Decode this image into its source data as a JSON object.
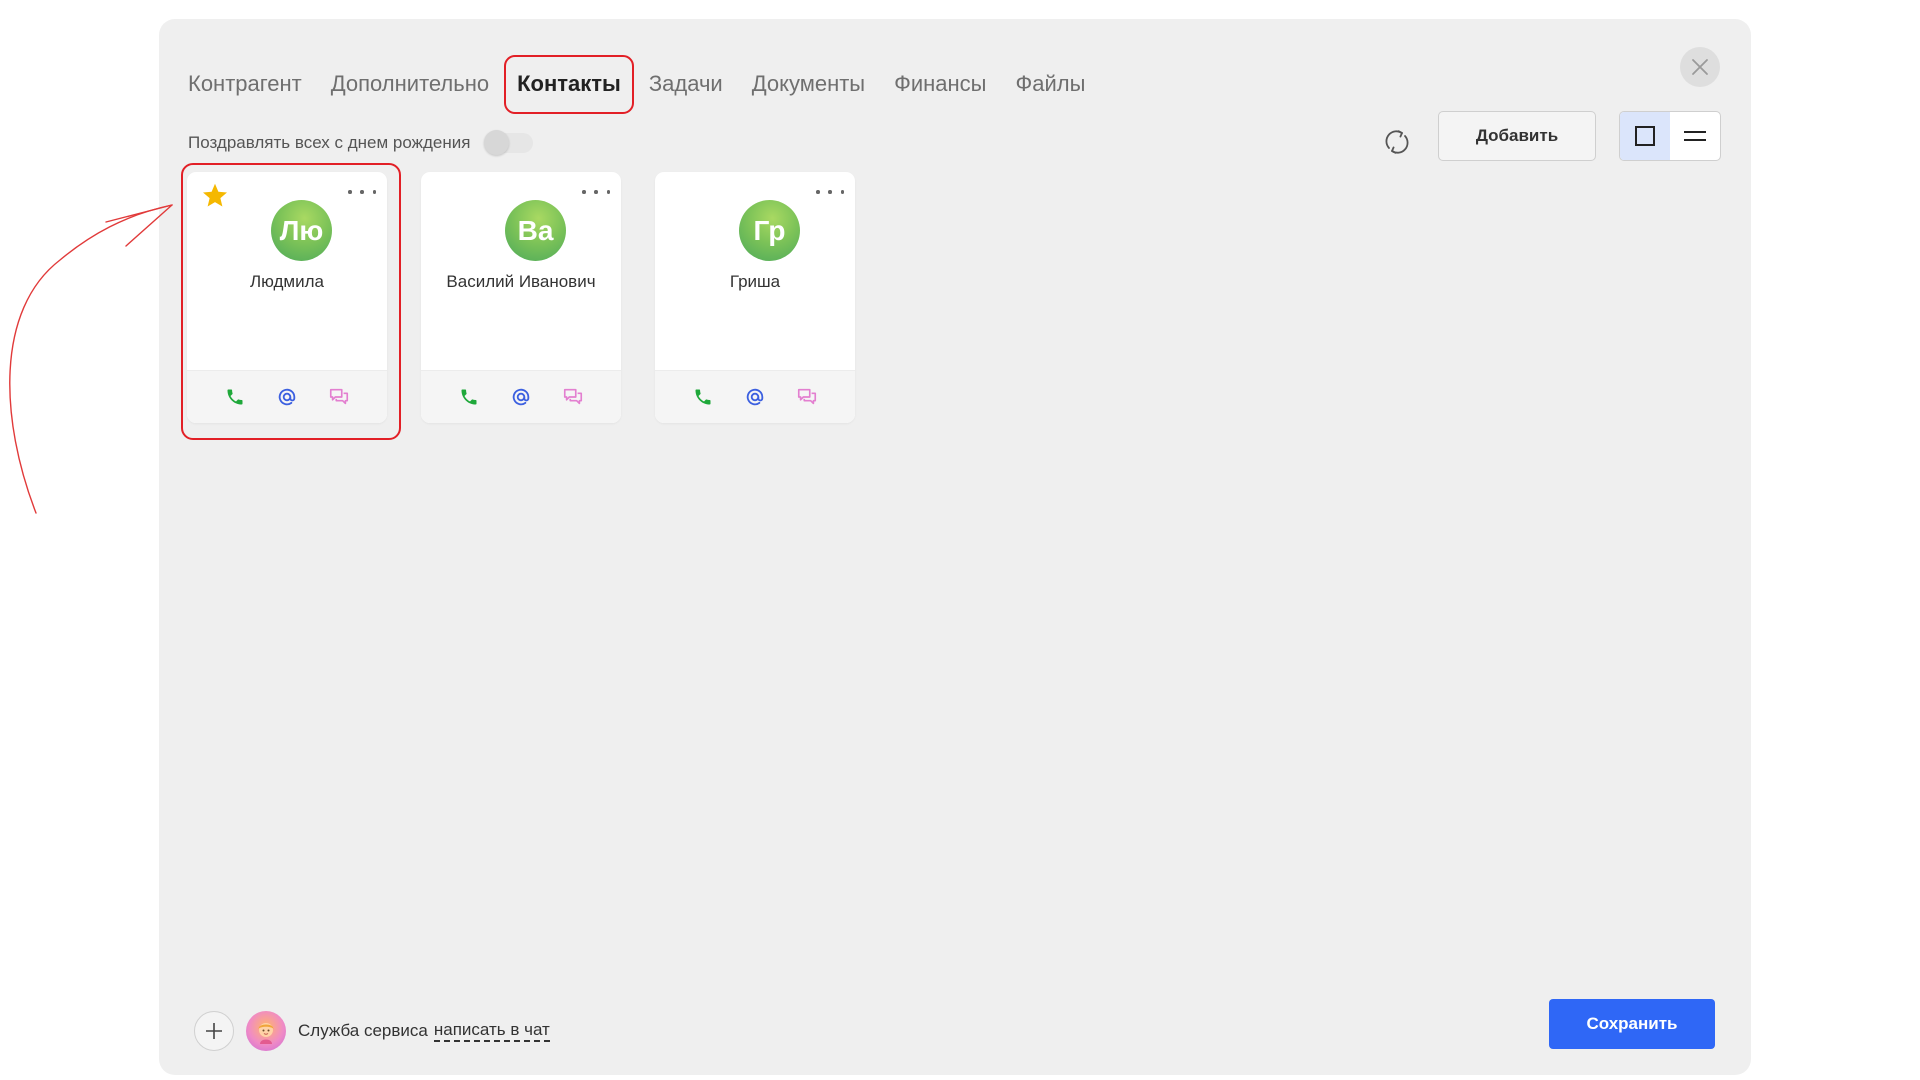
{
  "tabs": [
    {
      "label": "Контрагент"
    },
    {
      "label": "Дополнительно"
    },
    {
      "label": "Контакты",
      "active": true
    },
    {
      "label": "Задачи"
    },
    {
      "label": "Документы"
    },
    {
      "label": "Финансы"
    },
    {
      "label": "Файлы"
    }
  ],
  "toolbar": {
    "birthday_label": "Поздравлять всех с днем рождения",
    "birthday_enabled": false,
    "add_label": "Добавить",
    "view_mode": "cards",
    "icons": [
      "refresh-icon",
      "card-view-icon",
      "list-view-icon",
      "close-icon"
    ]
  },
  "contacts": [
    {
      "initials": "Лю",
      "name": "Людмила",
      "favorite": true
    },
    {
      "initials": "Ва",
      "name": "Василий Иванович",
      "favorite": false
    },
    {
      "initials": "Гр",
      "name": "Гриша",
      "favorite": false
    }
  ],
  "footer": {
    "support_label": "Служба сервиса",
    "chat_link": "написать в чат",
    "save_label": "Сохранить"
  },
  "colors": {
    "accent": "#2f67f6",
    "highlight": "#e21f26",
    "phone": "#1fa83a",
    "email": "#3c60e0",
    "chat": "#e37fd0",
    "star": "#f5b800",
    "avatar_green": "#7dc358"
  }
}
